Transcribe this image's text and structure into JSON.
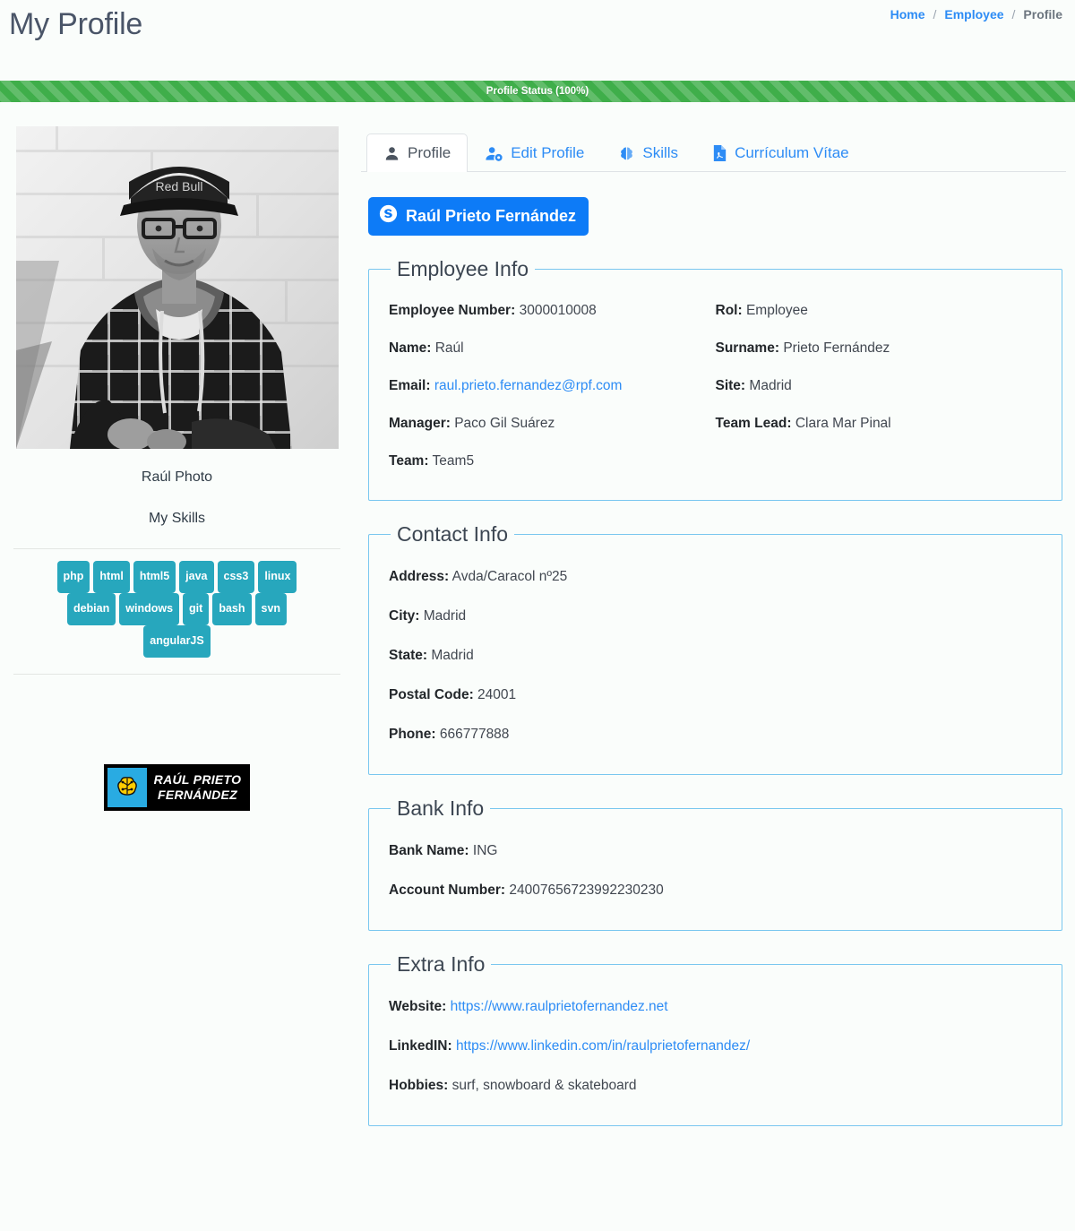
{
  "header": {
    "title": "My Profile",
    "breadcrumb": [
      {
        "label": "Home",
        "type": "link"
      },
      {
        "label": "/",
        "type": "sep"
      },
      {
        "label": "Employee",
        "type": "link"
      },
      {
        "label": "/",
        "type": "sep"
      },
      {
        "label": "Profile",
        "type": "current"
      }
    ]
  },
  "progress": {
    "label": "Profile Status (100%)",
    "percent": 100,
    "color": "#3fae4a"
  },
  "sidebar": {
    "photo_caption": "Raúl Photo",
    "photo_alt": "Grayscale portrait of a man wearing a Red Bull cap, glasses and a plaid hoodie sitting against a white brick wall",
    "skills_title": "My Skills",
    "skills": [
      "php",
      "html",
      "html5",
      "java",
      "css3",
      "linux",
      "debian",
      "windows",
      "git",
      "bash",
      "svn",
      "angularJS"
    ],
    "badge_color": "#27a7bd",
    "logo": {
      "line1": "RAÚL PRIETO",
      "line2": "FERNÁNDEZ",
      "icon_bg": "#29abe2",
      "icon_color": "#ffcc00",
      "bg": "#000000"
    }
  },
  "tabs": [
    {
      "label": "Profile",
      "icon": "user-icon",
      "active": true
    },
    {
      "label": "Edit Profile",
      "icon": "user-gear-icon",
      "active": false
    },
    {
      "label": "Skills",
      "icon": "brain-icon",
      "active": false
    },
    {
      "label": "Currículum Vítae",
      "icon": "file-pdf-icon",
      "active": false
    }
  ],
  "skype_button": {
    "label": "Raúl Prieto Fernández",
    "icon": "skype-icon",
    "color": "#0d7bf7"
  },
  "employee_info": {
    "legend": "Employee Info",
    "fields": [
      {
        "label": "Employee Number:",
        "value": "3000010008"
      },
      {
        "label": "Rol:",
        "value": "Employee"
      },
      {
        "label": "Name:",
        "value": "Raúl"
      },
      {
        "label": "Surname:",
        "value": "Prieto Fernández"
      },
      {
        "label": "Email:",
        "value": "raul.prieto.fernandez@rpf.com",
        "is_link": true
      },
      {
        "label": "Site:",
        "value": "Madrid"
      },
      {
        "label": "Manager:",
        "value": "Paco Gil Suárez"
      },
      {
        "label": "Team Lead:",
        "value": "Clara Mar Pinal"
      },
      {
        "label": "Team:",
        "value": "Team5"
      }
    ]
  },
  "contact_info": {
    "legend": "Contact Info",
    "fields": [
      {
        "label": "Address:",
        "value": "Avda/Caracol nº25"
      },
      {
        "label": "City:",
        "value": "Madrid"
      },
      {
        "label": "State:",
        "value": "Madrid"
      },
      {
        "label": "Postal Code:",
        "value": "24001"
      },
      {
        "label": "Phone:",
        "value": "666777888"
      }
    ]
  },
  "bank_info": {
    "legend": "Bank Info",
    "fields": [
      {
        "label": "Bank Name:",
        "value": "ING"
      },
      {
        "label": "Account Number:",
        "value": "24007656723992230230"
      }
    ]
  },
  "extra_info": {
    "legend": "Extra Info",
    "fields": [
      {
        "label": "Website:",
        "value": "https://www.raulprietofernandez.net",
        "is_link": true
      },
      {
        "label": "LinkedIN:",
        "value": "https://www.linkedin.com/in/raulprietofernandez/",
        "is_link": true
      },
      {
        "label": "Hobbies:",
        "value": "surf, snowboard & skateboard"
      }
    ]
  }
}
